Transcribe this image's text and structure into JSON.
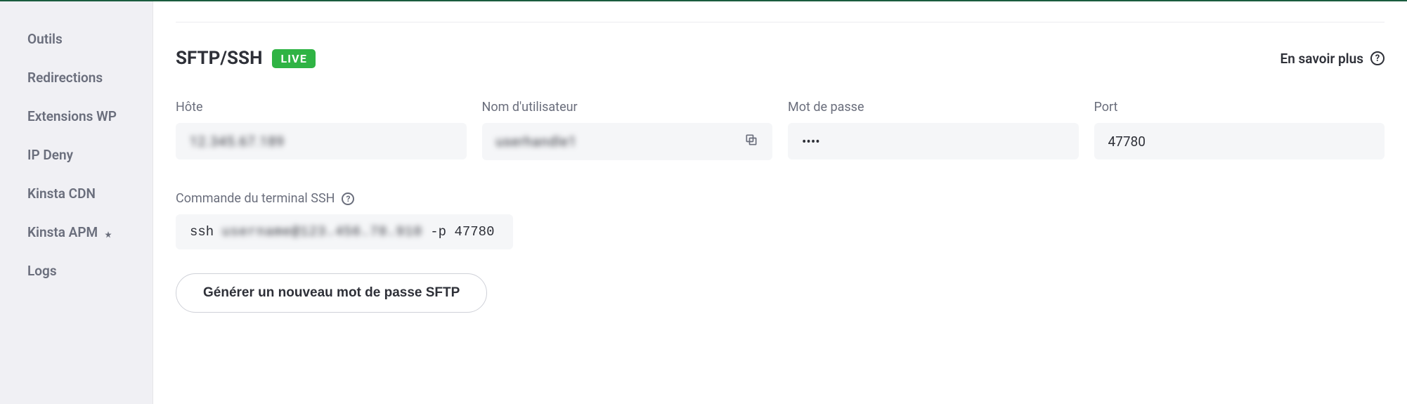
{
  "sidebar": {
    "items": [
      {
        "label": "Outils"
      },
      {
        "label": "Redirections"
      },
      {
        "label": "Extensions WP"
      },
      {
        "label": "IP Deny"
      },
      {
        "label": "Kinsta CDN"
      },
      {
        "label": "Kinsta APM"
      },
      {
        "label": "Logs"
      }
    ]
  },
  "header": {
    "title": "SFTP/SSH",
    "badge": "LIVE",
    "learn_more": "En savoir plus"
  },
  "fields": {
    "host": {
      "label": "Hôte",
      "value": "12.345.67.189"
    },
    "username": {
      "label": "Nom d'utilisateur",
      "value": "userhandle1"
    },
    "password": {
      "label": "Mot de passe",
      "value": "••••"
    },
    "port": {
      "label": "Port",
      "value": "47780"
    }
  },
  "ssh": {
    "label": "Commande du terminal SSH",
    "command_prefix": "ssh ",
    "command_redacted": "username@123.456.78.910",
    "command_suffix": " -p 47780"
  },
  "actions": {
    "generate_password": "Générer un nouveau mot de passe SFTP"
  }
}
